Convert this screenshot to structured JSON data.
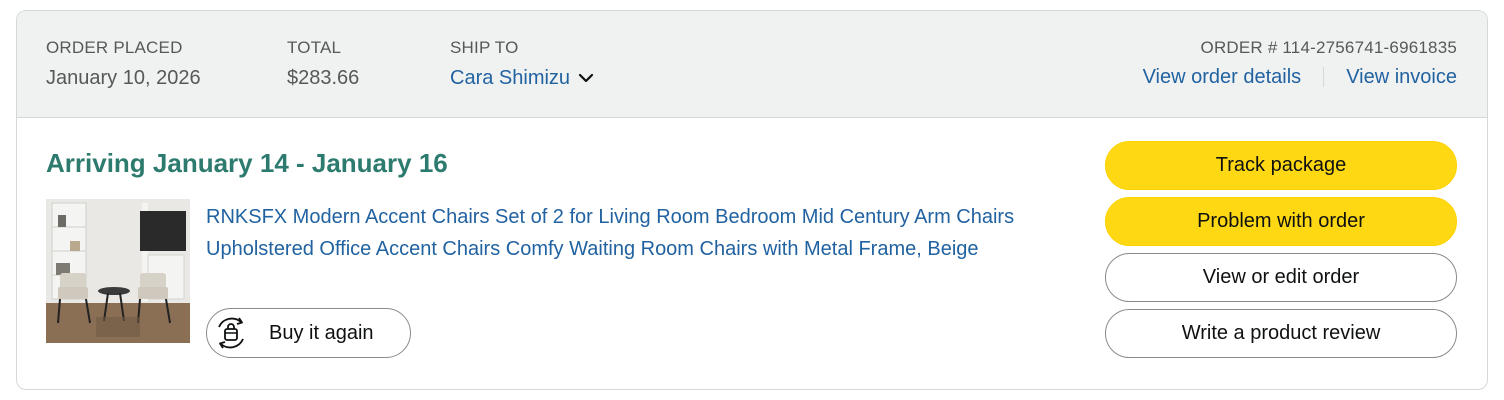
{
  "header": {
    "order_placed": {
      "label": "ORDER PLACED",
      "value": "January 10, 2026"
    },
    "total": {
      "label": "TOTAL",
      "value": "$283.66"
    },
    "ship_to": {
      "label": "SHIP TO",
      "value": "Cara Shimizu"
    },
    "order_number": "ORDER # 114-2756741-6961835",
    "links": {
      "details": "View order details",
      "invoice": "View invoice"
    }
  },
  "shipment": {
    "status": "Arriving January 14 - January 16",
    "product": {
      "title": "RNKSFX Modern Accent Chairs Set of 2 for Living Room Bedroom Mid Century Arm Chairs Upholstered Office Accent Chairs Comfy Waiting Room Chairs with Metal Frame, Beige",
      "buy_again_label": "Buy it again"
    }
  },
  "actions": {
    "track": "Track package",
    "problem": "Problem with order",
    "view_edit": "View or edit order",
    "review": "Write a product review"
  },
  "colors": {
    "accent_yellow": "#ffd814",
    "link_blue": "#2162a1",
    "arriving_green": "#2d7a6e",
    "header_bg": "#f0f2f2"
  },
  "icons": {
    "ship_to_toggle": "chevron-down-icon",
    "buy_again": "reorder-bag-icon"
  }
}
